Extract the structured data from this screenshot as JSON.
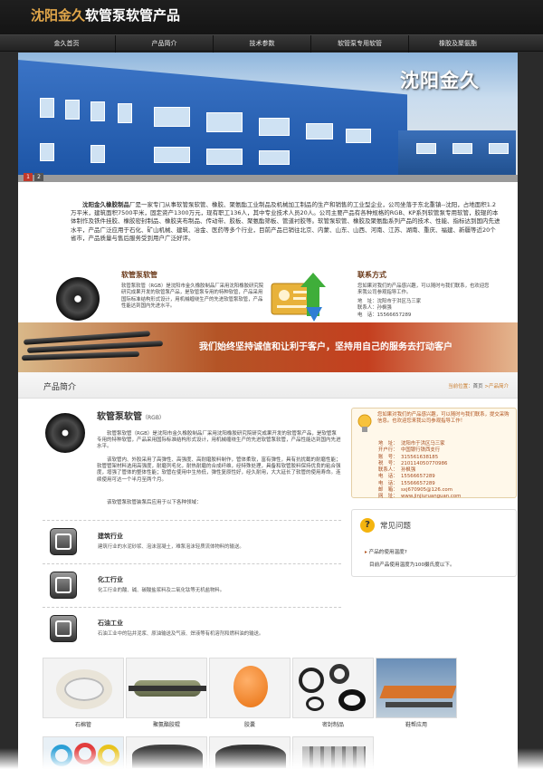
{
  "site": {
    "brand_part1": "沈阳金久",
    "brand_part2": "软管泵软管产品"
  },
  "nav": [
    "金久首页",
    "产品简介",
    "技术参数",
    "软管泵专用软管",
    "橡胶及聚氨酯"
  ],
  "banner": {
    "title": "沈阳金久",
    "pages": [
      "1",
      "2"
    ]
  },
  "about": {
    "company": "沈阳金久橡胶制品",
    "text": "厂是一家专门从事软管泵软管、橡胶、聚氨酯工业制品及机械加工制品的生产和销售的工业型企业，公司坐落于东北重镇--沈阳，占地面积1.2万平米，建筑面积7500平米，固定资产1300万元，现有职工136人，其中专业技术人员20人。公司主要产品有各种规格的RGB、KP系列软管泵专用软管，胶辊的本体制作及铁件挂胶、橡胶密封制品、橡胶夹布制品、传动带、胶板、聚氨酯筛板、管道衬胶等。软管泵软管、橡胶及聚氨酯系列产品的技术、性能、指标达到国内先进水平，产品广泛应用于石化、矿山机械、建筑、冶金、医药等多个行业，目前产品已销往北京、内蒙、山东、山西、河南、江苏、湖南、重庆、福建、新疆等近20个省市，产品质量与售后服务受到用户广泛好评。"
  },
  "section_hose": {
    "title": "软管泵软管",
    "text": "软管泵软管（RGB）是沈阳市金久橡胶制品厂采用沈阳橡胶研究院研究成果开发的软管泵产品，是软管泵专用的特种软管，产品采用国际标准结构形式设计，用机械缠绕生产的先进软管泵软管，产品性能达到国内先进水平。"
  },
  "section_contact": {
    "title": "联系方式",
    "text": "您如果对我们的产品感兴趣，可以随时与我们联系，也欢迎您来我公司参观指导工作。",
    "rows": [
      {
        "k": "地　址：",
        "v": "沈阳市于洪区马三家"
      },
      {
        "k": "联系人：",
        "v": "孙枫强"
      },
      {
        "k": "电　话：",
        "v": "15566657289"
      }
    ]
  },
  "slogan": "我们始终坚持诚信和让利于客户，坚持用自己的服务去打动客户",
  "lower": {
    "heading": "产品简介",
    "breadcrumb_prefix": "当前位置：",
    "breadcrumb_home": "首页",
    "breadcrumb_current": " >产品简介",
    "product_title": "软管泵软管",
    "product_sub": "（RGB）",
    "para1": "软管泵软管（RGB）是沈阳市金久橡胶制品厂采用沈阳橡胶研究院研究成果开发的软管泵产品，是软管泵专用的特种软管，产品采用国际标准结构形式设计，用机械缠绕生产的先进软管泵软管，产品性能达到国内先进水平。",
    "para2": "该软管内、外胶采用了高弹性、高强度、高耐磨胶料制作，管体柔软，富有弹性，具有抗扰截的耐磨性能；软管管架材料选用高强度，耐磨列毛化，耐热耐磨的合成纤维，经特殊处理，具备和软管胶料保持优良的粘合强度，增强了管体的整体性能；软管在使用中生热低，弹性复原性好，经久耐用，大大延长了软管的使用寿命。连续使用可达一个半月至两个月。",
    "para3": "该软管泵软管装泵后应用于以下各种领域：",
    "industries": [
      {
        "name": "建筑行业",
        "desc": "建筑行业的水泥砂浆、泡沫混凝土，难泵泡沫轻质流体物料的输送。"
      },
      {
        "name": "化工行业",
        "desc": "化工行业的酸、碱、碳酸盐浆料及二氧化钛等无机盐物料。"
      },
      {
        "name": "石油工业",
        "desc": "石油工业中的钻井泥浆、原油输送及气液、焊液等有机溶剂和燃料油的输送。"
      }
    ]
  },
  "contact_box": {
    "intro": "您如果对我们的产品感兴趣，可以随时与我们联系，提交采购信息。也欢迎您来我公司参观指导工作！",
    "rows": [
      {
        "k": "地　址：",
        "v": "沈阳市于洪区马三家"
      },
      {
        "k": "开户行：",
        "v": "中国银行铁西支行"
      },
      {
        "k": "账　号：",
        "v": "315561638185"
      },
      {
        "k": "税　号：",
        "v": "210114050770986"
      },
      {
        "k": "联系人：",
        "v": "孙枫强"
      },
      {
        "k": "电　话：",
        "v": "15566657289"
      },
      {
        "k": "电　话：",
        "v": "15566657289"
      },
      {
        "k": "邮　箱：",
        "v": "sxj670905@126.com"
      },
      {
        "k": "网　址：",
        "v": "www.jinjiuruanguan.com"
      }
    ]
  },
  "faq": {
    "title": "常见问题",
    "question": "产品的使用温度?",
    "answer": "目前产品使用温度为100摄氏度以下。"
  },
  "gallery": [
    "石棉管",
    "聚氨酯胶辊",
    "胶囊",
    "密封制品",
    "鞋帮应用"
  ],
  "colors": {
    "accent": "#e0a64a",
    "brown_title": "#6b3a1a",
    "contact_text": "#a34a1e",
    "banner_red": "#c43f1f"
  }
}
